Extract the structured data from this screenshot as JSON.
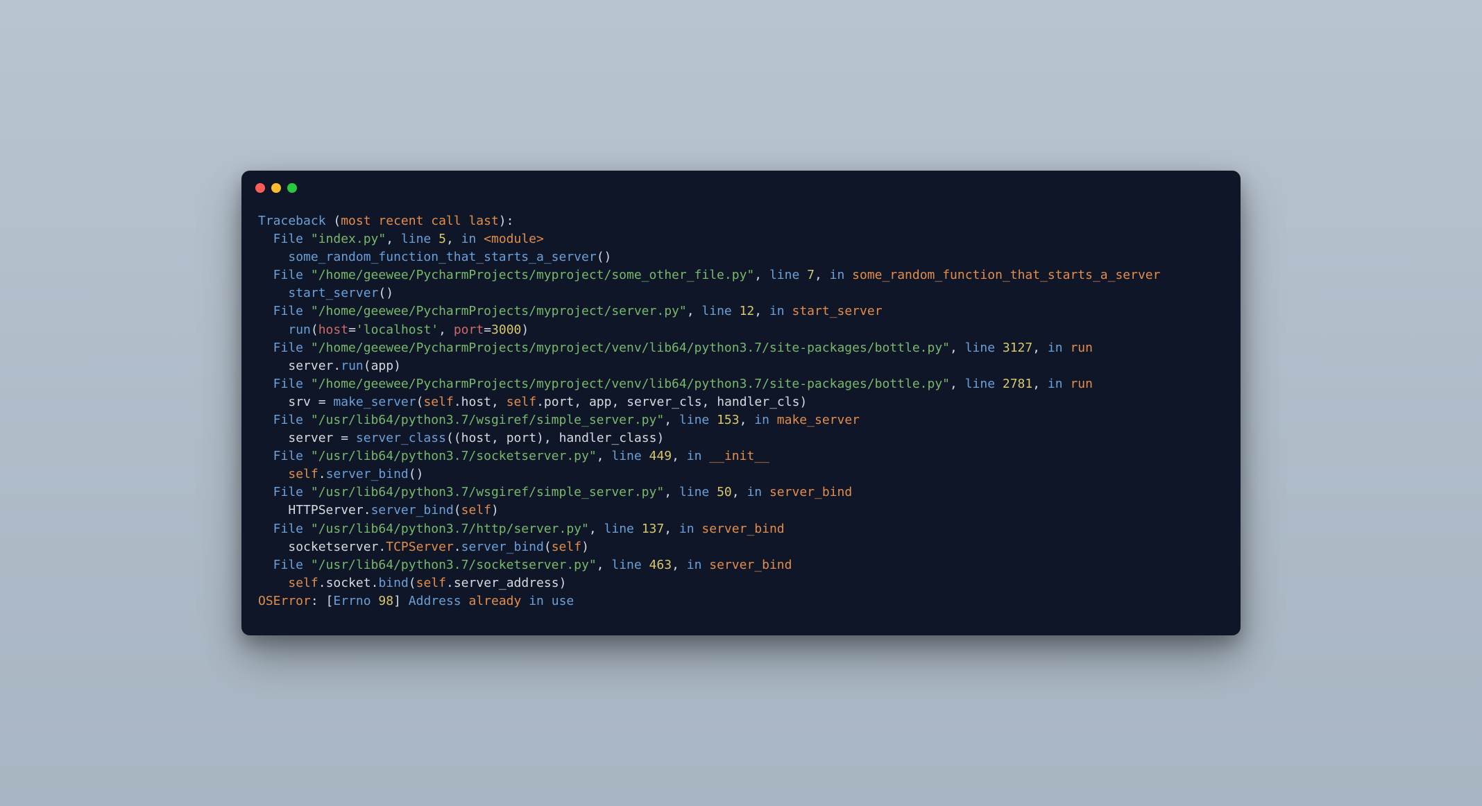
{
  "colors": {
    "bg": "#0e1628",
    "blue": "#6aa0d8",
    "orange": "#e38d4a",
    "green": "#78b86b",
    "yellow": "#d8c96a",
    "white": "#d6dbe0",
    "grey": "#889099",
    "red": "#d06a6a"
  },
  "traceback": {
    "header_prefix": "Traceback ",
    "header_paren_open": "(",
    "header_text": "most recent call last",
    "header_paren_close": "):",
    "frames": [
      {
        "file": "index.py",
        "line": "5",
        "func": "<module>",
        "code": [
          {
            "t": "some_random_function_that_starts_a_server",
            "c": "blue"
          },
          {
            "t": "()",
            "c": "white"
          }
        ]
      },
      {
        "file": "/home/geewee/PycharmProjects/myproject/some_other_file.py",
        "line": "7",
        "func": "some_random_function_that_starts_a_server",
        "code": [
          {
            "t": "start_server",
            "c": "blue"
          },
          {
            "t": "()",
            "c": "white"
          }
        ]
      },
      {
        "file": "/home/geewee/PycharmProjects/myproject/server.py",
        "line": "12",
        "func": "start_server",
        "code": [
          {
            "t": "run",
            "c": "blue"
          },
          {
            "t": "(",
            "c": "white"
          },
          {
            "t": "host",
            "c": "red"
          },
          {
            "t": "=",
            "c": "white"
          },
          {
            "t": "'localhost'",
            "c": "green"
          },
          {
            "t": ", ",
            "c": "white"
          },
          {
            "t": "port",
            "c": "red"
          },
          {
            "t": "=",
            "c": "white"
          },
          {
            "t": "3000",
            "c": "yellow"
          },
          {
            "t": ")",
            "c": "white"
          }
        ]
      },
      {
        "file": "/home/geewee/PycharmProjects/myproject/venv/lib64/python3.7/site-packages/bottle.py",
        "line": "3127",
        "func": "run",
        "code": [
          {
            "t": "server",
            "c": "white"
          },
          {
            "t": ".",
            "c": "white"
          },
          {
            "t": "run",
            "c": "blue"
          },
          {
            "t": "(",
            "c": "white"
          },
          {
            "t": "app",
            "c": "white"
          },
          {
            "t": ")",
            "c": "white"
          }
        ]
      },
      {
        "file": "/home/geewee/PycharmProjects/myproject/venv/lib64/python3.7/site-packages/bottle.py",
        "line": "2781",
        "func": "run",
        "code": [
          {
            "t": "srv ",
            "c": "white"
          },
          {
            "t": "=",
            "c": "white"
          },
          {
            "t": " make_server",
            "c": "blue"
          },
          {
            "t": "(",
            "c": "white"
          },
          {
            "t": "self",
            "c": "orange"
          },
          {
            "t": ".",
            "c": "white"
          },
          {
            "t": "host",
            "c": "white"
          },
          {
            "t": ", ",
            "c": "white"
          },
          {
            "t": "self",
            "c": "orange"
          },
          {
            "t": ".",
            "c": "white"
          },
          {
            "t": "port",
            "c": "white"
          },
          {
            "t": ", ",
            "c": "white"
          },
          {
            "t": "app",
            "c": "white"
          },
          {
            "t": ", ",
            "c": "white"
          },
          {
            "t": "server_cls",
            "c": "white"
          },
          {
            "t": ", ",
            "c": "white"
          },
          {
            "t": "handler_cls",
            "c": "white"
          },
          {
            "t": ")",
            "c": "white"
          }
        ]
      },
      {
        "file": "/usr/lib64/python3.7/wsgiref/simple_server.py",
        "line": "153",
        "func": "make_server",
        "code": [
          {
            "t": "server ",
            "c": "white"
          },
          {
            "t": "=",
            "c": "white"
          },
          {
            "t": " server_class",
            "c": "blue"
          },
          {
            "t": "((",
            "c": "white"
          },
          {
            "t": "host",
            "c": "white"
          },
          {
            "t": ", ",
            "c": "white"
          },
          {
            "t": "port",
            "c": "white"
          },
          {
            "t": "), ",
            "c": "white"
          },
          {
            "t": "handler_class",
            "c": "white"
          },
          {
            "t": ")",
            "c": "white"
          }
        ]
      },
      {
        "file": "/usr/lib64/python3.7/socketserver.py",
        "line": "449",
        "func": "__init__",
        "code": [
          {
            "t": "self",
            "c": "orange"
          },
          {
            "t": ".",
            "c": "white"
          },
          {
            "t": "server_bind",
            "c": "blue"
          },
          {
            "t": "()",
            "c": "white"
          }
        ]
      },
      {
        "file": "/usr/lib64/python3.7/wsgiref/simple_server.py",
        "line": "50",
        "func": "server_bind",
        "code": [
          {
            "t": "HTTPServer",
            "c": "white"
          },
          {
            "t": ".",
            "c": "white"
          },
          {
            "t": "server_bind",
            "c": "blue"
          },
          {
            "t": "(",
            "c": "white"
          },
          {
            "t": "self",
            "c": "orange"
          },
          {
            "t": ")",
            "c": "white"
          }
        ]
      },
      {
        "file": "/usr/lib64/python3.7/http/server.py",
        "line": "137",
        "func": "server_bind",
        "code": [
          {
            "t": "socketserver",
            "c": "white"
          },
          {
            "t": ".",
            "c": "white"
          },
          {
            "t": "TCPServer",
            "c": "orange"
          },
          {
            "t": ".",
            "c": "white"
          },
          {
            "t": "server_bind",
            "c": "blue"
          },
          {
            "t": "(",
            "c": "white"
          },
          {
            "t": "self",
            "c": "orange"
          },
          {
            "t": ")",
            "c": "white"
          }
        ]
      },
      {
        "file": "/usr/lib64/python3.7/socketserver.py",
        "line": "463",
        "func": "server_bind",
        "code": [
          {
            "t": "self",
            "c": "orange"
          },
          {
            "t": ".",
            "c": "white"
          },
          {
            "t": "socket",
            "c": "white"
          },
          {
            "t": ".",
            "c": "white"
          },
          {
            "t": "bind",
            "c": "blue"
          },
          {
            "t": "(",
            "c": "white"
          },
          {
            "t": "self",
            "c": "orange"
          },
          {
            "t": ".",
            "c": "white"
          },
          {
            "t": "server_address",
            "c": "white"
          },
          {
            "t": ")",
            "c": "white"
          }
        ]
      }
    ],
    "labels": {
      "file": "File",
      "line": "line",
      "in": "in"
    },
    "error": {
      "type": "OSError",
      "colon": ": ",
      "bracket_open": "[",
      "errno_label": "Errno ",
      "errno_num": "98",
      "bracket_close": "]",
      "msg_head": " Address ",
      "msg_tail1": "already ",
      "msg_tail2": "in",
      "msg_tail3": " use"
    }
  }
}
